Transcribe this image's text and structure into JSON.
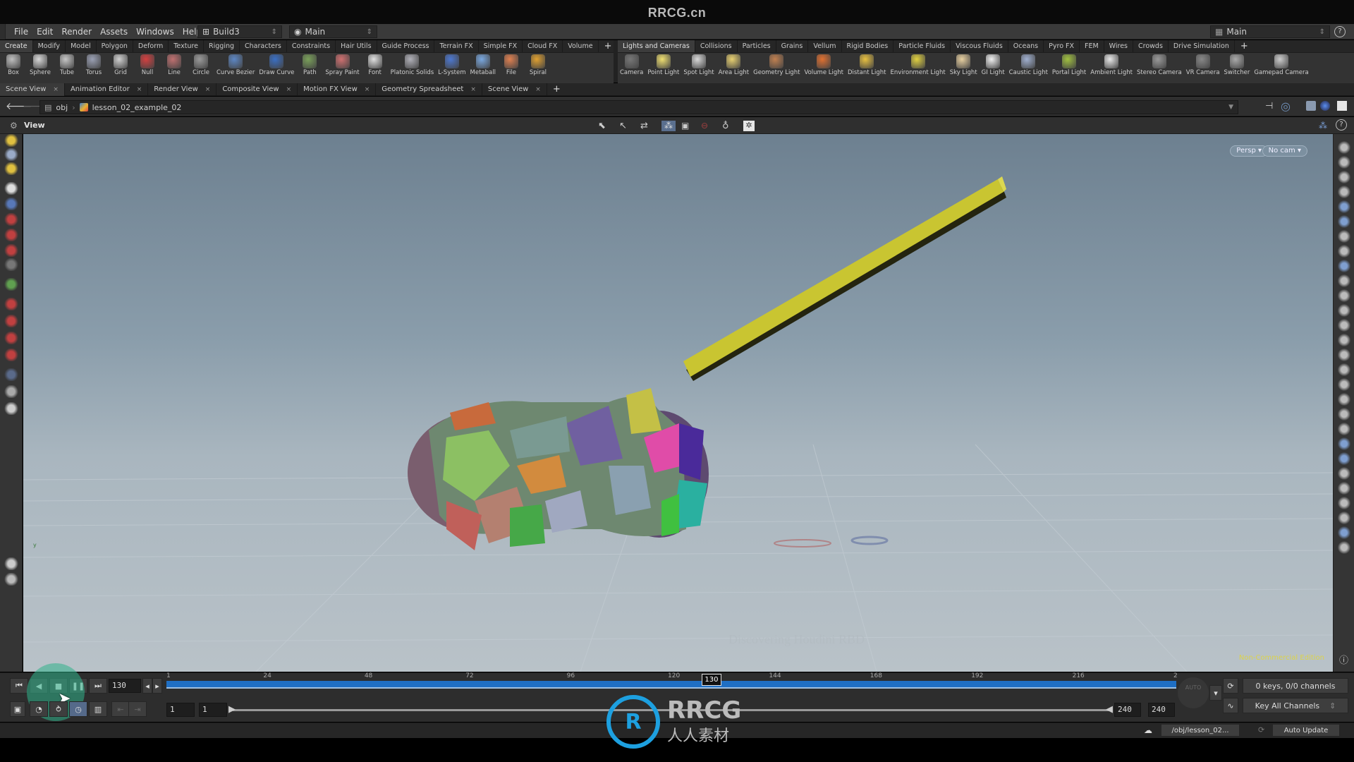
{
  "watermark_top": "RRCG.cn",
  "menu": [
    "File",
    "Edit",
    "Render",
    "Assets",
    "Windows",
    "Help"
  ],
  "desktop": {
    "build": "Build3",
    "main": "Main"
  },
  "right_desktop": "Main",
  "shelf_left": {
    "tabs": [
      "Create",
      "Modify",
      "Model",
      "Polygon",
      "Deform",
      "Texture",
      "Rigging",
      "Characters",
      "Constraints",
      "Hair Utils",
      "Guide Process",
      "Terrain FX",
      "Simple FX",
      "Cloud FX",
      "Volume"
    ],
    "tools": [
      "Box",
      "Sphere",
      "Tube",
      "Torus",
      "Grid",
      "Null",
      "Line",
      "Circle",
      "Curve Bezier",
      "Draw Curve",
      "Path",
      "Spray Paint",
      "Font",
      "Platonic Solids",
      "L-System",
      "Metaball",
      "File",
      "Spiral"
    ]
  },
  "shelf_right": {
    "tabs": [
      "Lights and Cameras",
      "Collisions",
      "Particles",
      "Grains",
      "Vellum",
      "Rigid Bodies",
      "Particle Fluids",
      "Viscous Fluids",
      "Oceans",
      "Pyro FX",
      "FEM",
      "Wires",
      "Crowds",
      "Drive Simulation"
    ],
    "tools": [
      "Camera",
      "Point Light",
      "Spot Light",
      "Area Light",
      "Geometry Light",
      "Volume Light",
      "Distant Light",
      "Environment Light",
      "Sky Light",
      "GI Light",
      "Caustic Light",
      "Portal Light",
      "Ambient Light",
      "Stereo Camera",
      "VR Camera",
      "Switcher",
      "Gamepad Camera"
    ]
  },
  "pane_tabs": [
    "Scene View",
    "Animation Editor",
    "Render View",
    "Composite View",
    "Motion FX View",
    "Geometry Spreadsheet",
    "Scene View"
  ],
  "path": {
    "root": "obj",
    "node": "lesson_02_example_02"
  },
  "view": {
    "label": "View",
    "persp": "Persp",
    "cam": "No cam",
    "edition": "Non-Commercial Edition",
    "overlay": "Discovering Houdini RBD"
  },
  "timeline": {
    "current_frame": "130",
    "marker": "130",
    "ticks": [
      "1",
      "24",
      "48",
      "72",
      "96",
      "120",
      "144",
      "168",
      "192",
      "216",
      "2"
    ],
    "range_start": "1",
    "range_start2": "1",
    "range_end": "240",
    "range_end2": "240",
    "keys_status": "0 keys, 0/0 channels",
    "key_mode": "Key All Channels",
    "auto_label": "AUTO"
  },
  "status": {
    "path": "/obj/lesson_02...",
    "update": "Auto Update"
  },
  "logo": {
    "en": "RRCG",
    "cn": "人人素材"
  },
  "colors": {
    "accent": "#1f6fc4",
    "yellow_bar": "#c9c531",
    "playback_highlight": "#2fb38a"
  }
}
